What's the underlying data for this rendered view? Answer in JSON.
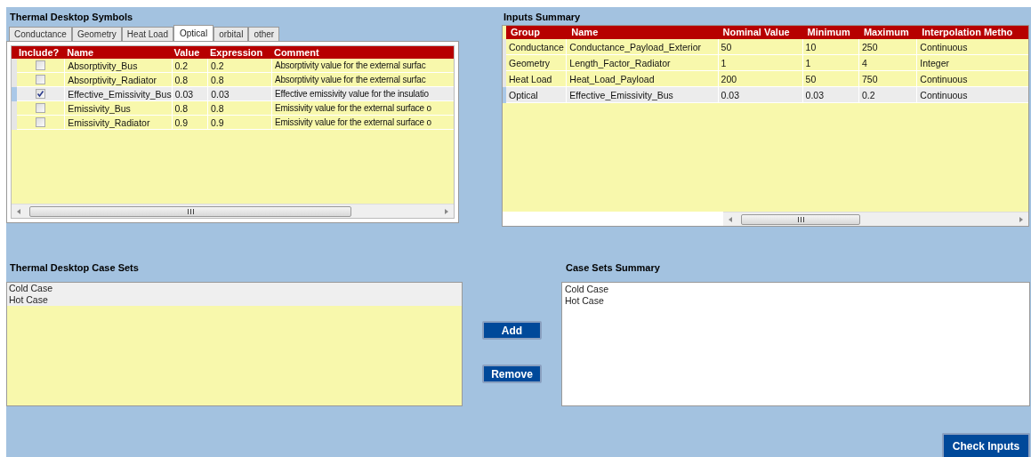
{
  "symbols": {
    "title": "Thermal Desktop Symbols",
    "tabs": [
      {
        "label": "Conductance",
        "selected": false
      },
      {
        "label": "Geometry",
        "selected": false
      },
      {
        "label": "Heat Load",
        "selected": false
      },
      {
        "label": "Optical",
        "selected": true
      },
      {
        "label": "orbital",
        "selected": false
      },
      {
        "label": "other",
        "selected": false
      }
    ],
    "columns": [
      "Include?",
      "Name",
      "Value",
      "Expression",
      "Comment"
    ],
    "rows": [
      {
        "include": false,
        "selected": false,
        "name": "Absorptivity_Bus",
        "value": "0.2",
        "expression": "0.2",
        "comment": "Absorptivity value for the external surfac"
      },
      {
        "include": false,
        "selected": false,
        "name": "Absorptivity_Radiator",
        "value": "0.8",
        "expression": "0.8",
        "comment": "Absorptivity value for the external surfac"
      },
      {
        "include": true,
        "selected": true,
        "name": "Effective_Emissivity_Bus",
        "value": "0.03",
        "expression": "0.03",
        "comment": "Effective emissivity value for the insulatio"
      },
      {
        "include": false,
        "selected": false,
        "name": "Emissivity_Bus",
        "value": "0.8",
        "expression": "0.8",
        "comment": "Emissivity value for the external surface o"
      },
      {
        "include": false,
        "selected": false,
        "name": "Emissivity_Radiator",
        "value": "0.9",
        "expression": "0.9",
        "comment": "Emissivity value for the external surface o"
      }
    ]
  },
  "summary": {
    "title": "Inputs Summary",
    "columns": [
      "Group",
      "Name",
      "Nominal Value",
      "Minimum",
      "Maximum",
      "Interpolation Metho"
    ],
    "rows": [
      {
        "selected": false,
        "cells": [
          "Conductance",
          "Conductance_Payload_Exterior",
          "50",
          "10",
          "250",
          "Continuous"
        ]
      },
      {
        "selected": false,
        "cells": [
          "Geometry",
          "Length_Factor_Radiator",
          "1",
          "1",
          "4",
          "Integer"
        ]
      },
      {
        "selected": false,
        "cells": [
          "Heat Load",
          "Heat_Load_Payload",
          "200",
          "50",
          "750",
          "Continuous"
        ]
      },
      {
        "selected": true,
        "cells": [
          "Optical",
          "Effective_Emissivity_Bus",
          "0.03",
          "0.03",
          "0.2",
          "Continuous"
        ]
      }
    ]
  },
  "case_sets": {
    "title": "Thermal Desktop Case Sets",
    "items": [
      {
        "label": "Cold Case",
        "selected": true
      },
      {
        "label": "Hot Case",
        "selected": true
      }
    ]
  },
  "case_summary": {
    "title": "Case Sets Summary",
    "items": [
      {
        "label": "Cold Case"
      },
      {
        "label": "Hot Case"
      }
    ]
  },
  "buttons": {
    "add": "Add",
    "remove": "Remove",
    "check": "Check Inputs"
  }
}
